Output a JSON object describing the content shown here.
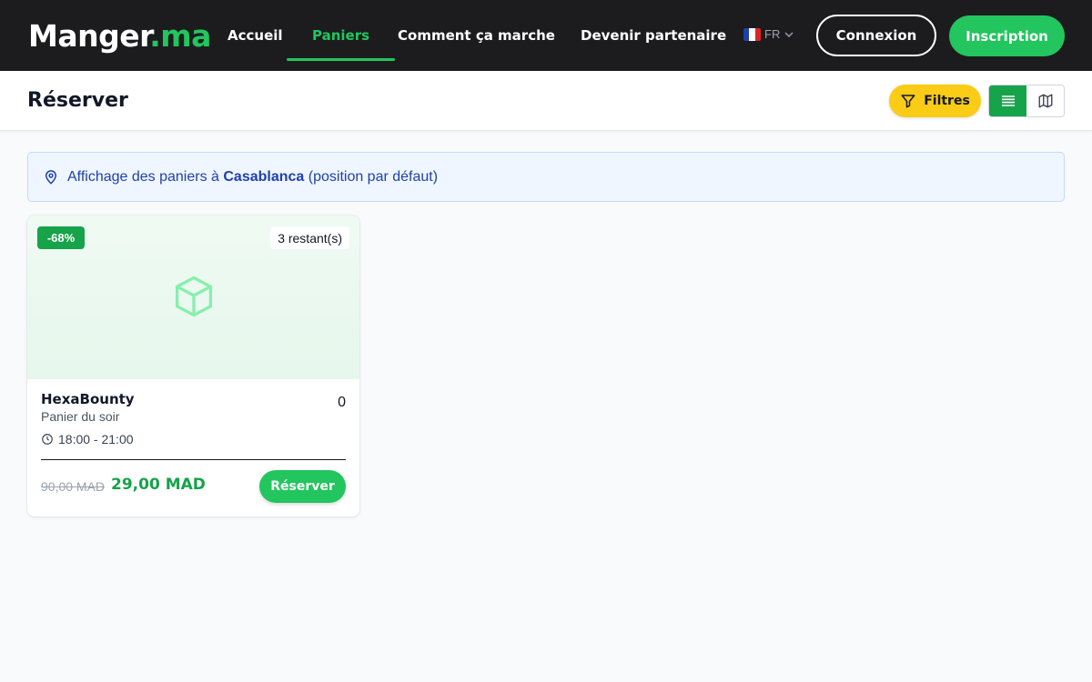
{
  "nav": {
    "logo_main": "Manger",
    "logo_tld": ".ma",
    "links": [
      {
        "label": "Accueil",
        "active": false
      },
      {
        "label": "Paniers",
        "active": true
      },
      {
        "label": "Comment ça marche",
        "active": false
      },
      {
        "label": "Devenir partenaire",
        "active": false
      }
    ],
    "language": "FR",
    "login_label": "Connexion",
    "signup_label": "Inscription"
  },
  "subheader": {
    "title": "Réserver",
    "filters_label": "Filtres",
    "view_mode": "list"
  },
  "info_banner": {
    "prefix": "Affichage des paniers à ",
    "city": "Casablanca",
    "suffix": " (position par défaut)"
  },
  "cards": [
    {
      "discount": "-68%",
      "remaining": "3 restant(s)",
      "title": "HexaBounty",
      "rating": "0",
      "subtitle": "Panier du soir",
      "time": "18:00 - 21:00",
      "old_price": "90,00 MAD",
      "new_price": "29,00 MAD",
      "button_label": "Réserver"
    }
  ],
  "colors": {
    "brand_green": "#22c55e",
    "dark_nav": "#1c1c1e",
    "filter_yellow": "#facc15",
    "info_blue": "#1e40af"
  },
  "icons": {
    "filter": "filter-icon",
    "list_view": "list-icon",
    "map_view": "map-icon",
    "location": "map-pin-icon",
    "placeholder": "box-icon",
    "time": "clock-icon",
    "language_chevron": "chevron-down-icon"
  }
}
